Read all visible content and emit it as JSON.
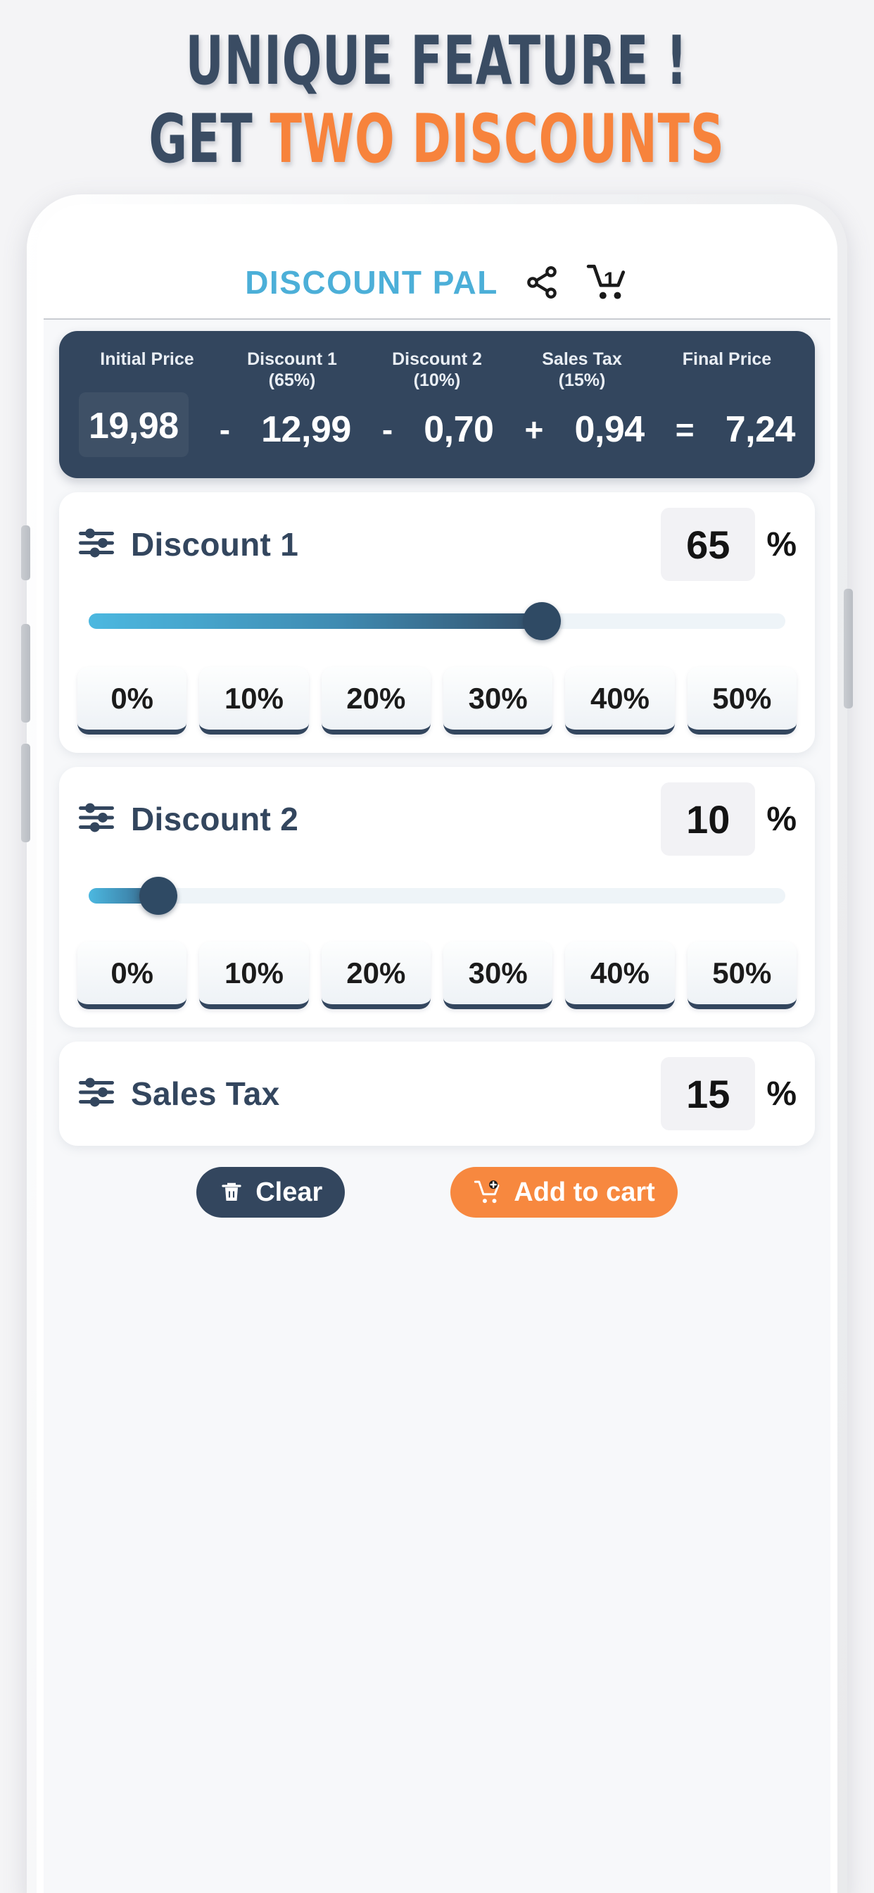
{
  "promo": {
    "line1": "UNIQUE FEATURE !",
    "line2_prefix": "GET",
    "line2_highlight": "TWO DISCOUNTS",
    "navy": "#3a4c63",
    "orange": "#f7833c"
  },
  "app": {
    "title": "DISCOUNT PAL",
    "title_color": "#4cafd8",
    "share_icon": "share-icon",
    "cart_icon": "shopping-cart-icon",
    "cart_count": "1"
  },
  "summary": {
    "headers": [
      {
        "line1": "Initial Price",
        "line2": ""
      },
      {
        "line1": "Discount 1",
        "line2": "(65%)"
      },
      {
        "line1": "Discount 2",
        "line2": "(10%)"
      },
      {
        "line1": "Sales Tax",
        "line2": "(15%)"
      },
      {
        "line1": "Final Price",
        "line2": ""
      }
    ],
    "initial_price": "19,98",
    "op1": "-",
    "discount1_amount": "12,99",
    "op2": "-",
    "discount2_amount": "0,70",
    "op3": "+",
    "tax_amount": "0,94",
    "op4": "=",
    "final_price": "7,24",
    "bg_color": "#33465e"
  },
  "discount1": {
    "label": "Discount 1",
    "value": "65",
    "percent_sign": "%",
    "slider_percent": 65,
    "presets": [
      "0%",
      "10%",
      "20%",
      "30%",
      "40%",
      "50%"
    ]
  },
  "discount2": {
    "label": "Discount 2",
    "value": "10",
    "percent_sign": "%",
    "slider_percent": 10,
    "presets": [
      "0%",
      "10%",
      "20%",
      "30%",
      "40%",
      "50%"
    ]
  },
  "sales_tax": {
    "label": "Sales Tax",
    "value": "15",
    "percent_sign": "%"
  },
  "actions": {
    "clear_label": "Clear",
    "clear_icon": "trash-icon",
    "clear_color": "#33465e",
    "cart_label": "Add to cart",
    "cart_icon": "cart-plus-icon",
    "cart_color": "#f7883f"
  }
}
